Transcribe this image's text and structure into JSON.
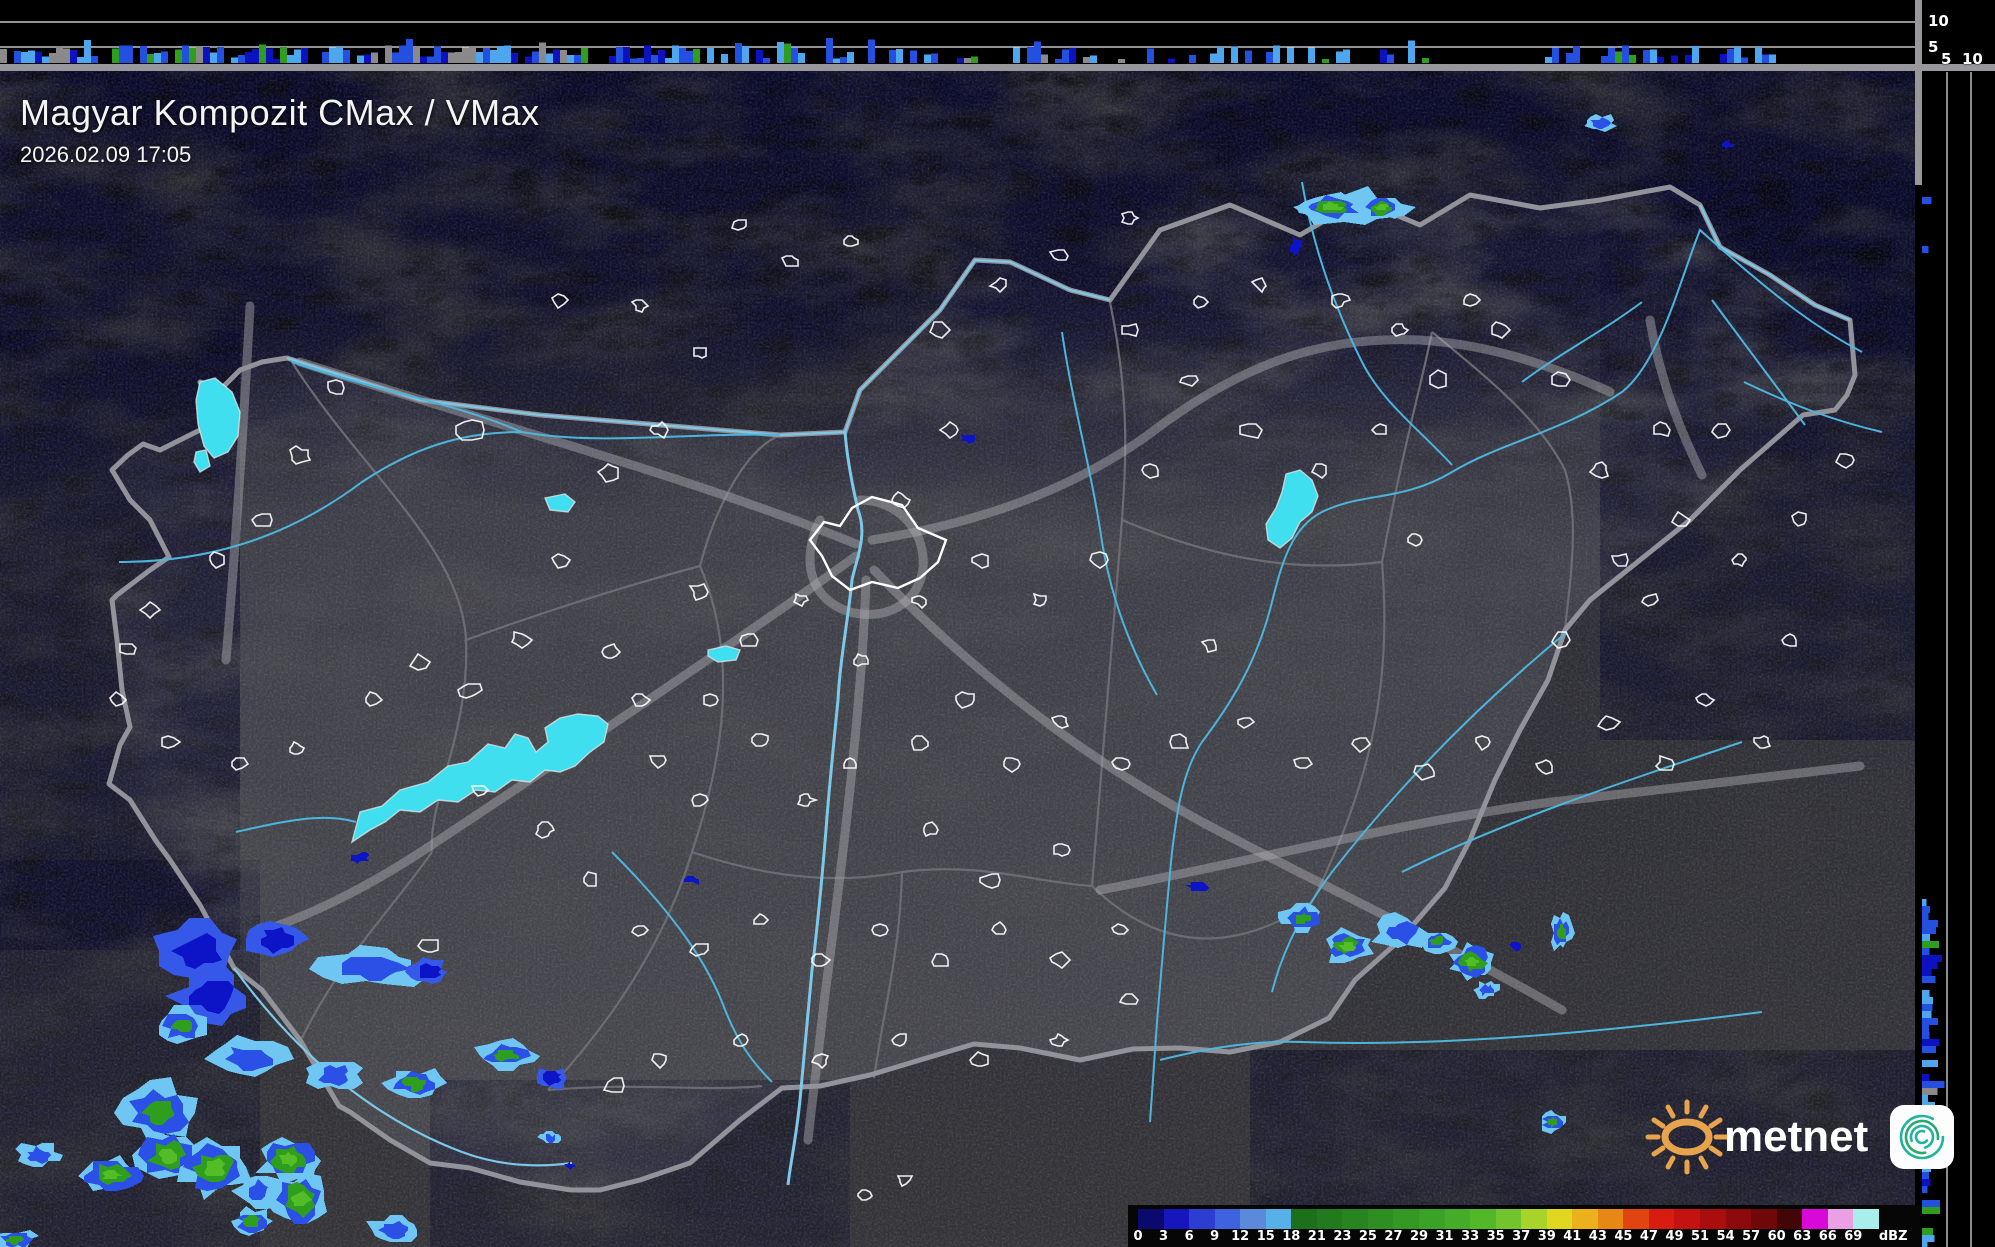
{
  "header": {
    "title": "Magyar Kompozit CMax / VMax",
    "timestamp": "2026.02.09 17:05"
  },
  "cross_sections": {
    "top_profile": {
      "gridline_labels": [
        "10",
        "5"
      ]
    },
    "right_profile": {
      "gridline_labels": [
        "5",
        "10"
      ]
    }
  },
  "colorbar": {
    "unit": "dBZ",
    "stops": [
      {
        "label": "0",
        "color": "#0a0a6e"
      },
      {
        "label": "3",
        "color": "#1616bc"
      },
      {
        "label": "6",
        "color": "#2c3ed2"
      },
      {
        "label": "9",
        "color": "#3f62de"
      },
      {
        "label": "12",
        "color": "#5b8ada"
      },
      {
        "label": "15",
        "color": "#58b0e8"
      },
      {
        "label": "18",
        "color": "#1c701c"
      },
      {
        "label": "21",
        "color": "#227a1e"
      },
      {
        "label": "23",
        "color": "#288420"
      },
      {
        "label": "25",
        "color": "#2e8e22"
      },
      {
        "label": "27",
        "color": "#349824"
      },
      {
        "label": "29",
        "color": "#3aa226"
      },
      {
        "label": "31",
        "color": "#44ac28"
      },
      {
        "label": "33",
        "color": "#52b82a"
      },
      {
        "label": "35",
        "color": "#72c42e"
      },
      {
        "label": "37",
        "color": "#a8d42a"
      },
      {
        "label": "39",
        "color": "#e0d820"
      },
      {
        "label": "41",
        "color": "#ecb01c"
      },
      {
        "label": "43",
        "color": "#e88814"
      },
      {
        "label": "45",
        "color": "#e04410"
      },
      {
        "label": "47",
        "color": "#d81c10"
      },
      {
        "label": "49",
        "color": "#c41210"
      },
      {
        "label": "51",
        "color": "#a80e0e"
      },
      {
        "label": "54",
        "color": "#8c0a0c"
      },
      {
        "label": "57",
        "color": "#700809"
      },
      {
        "label": "60",
        "color": "#440506"
      },
      {
        "label": "63",
        "color": "#d808d8"
      },
      {
        "label": "66",
        "color": "#eca0e4"
      },
      {
        "label": "69",
        "color": "#a8eeea"
      }
    ]
  },
  "logo": {
    "text": "metnet"
  },
  "palette": {
    "echo_light_blue": "#6fc6f2",
    "echo_blue": "#2b50e6",
    "echo_dark_blue": "#0d13c6",
    "echo_green": "#2f9e1f",
    "echo_bright_green": "#52bd27",
    "lake": "#3fdff0",
    "river": "#4db4dc",
    "country_border": "#92929a",
    "logo_orange": "#e8a44c",
    "logo_teal": "#1fb49c"
  }
}
